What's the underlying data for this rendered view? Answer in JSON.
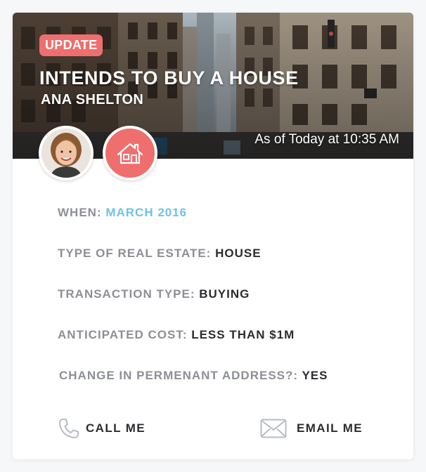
{
  "card": {
    "badge": "UPDATE",
    "title": "INTENDS TO BUY A HOUSE",
    "name": "ANA SHELTON",
    "timestamp": "As of Today at 10:35 AM"
  },
  "details": {
    "rows": [
      {
        "label": "WHEN:",
        "value": "MARCH 2016"
      },
      {
        "label": "TYPE OF REAL ESTATE:",
        "value": "HOUSE"
      },
      {
        "label": "TRANSACTION TYPE:",
        "value": "BUYING"
      },
      {
        "label": "ANTICIPATED COST:",
        "value": "LESS THAN $1M"
      },
      {
        "label": "CHANGE IN PERMENANT ADDRESS?:",
        "value": "YES"
      }
    ]
  },
  "actions": {
    "call_label": "CALL ME",
    "email_label": "EMAIL ME"
  },
  "icons": {
    "avatar": "person-avatar",
    "type": "house-icon",
    "call": "phone-icon",
    "email": "envelope-icon"
  },
  "colors": {
    "accent_red": "#ee6f6d",
    "accent_blue": "#6ec2ea",
    "label_gray": "#8d8f96",
    "value_dark": "#2b2c30"
  }
}
